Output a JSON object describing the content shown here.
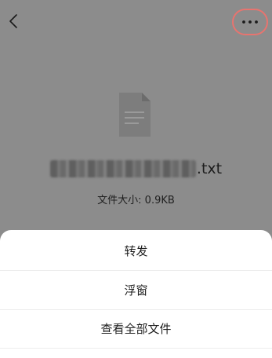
{
  "topbar": {
    "back_icon": "chevron-left-icon",
    "more_icon": "more-horizontal-icon",
    "highlight_color": "#e8746f"
  },
  "file": {
    "icon": "document-icon",
    "name_extension": ".txt",
    "size_label": "文件大小: 0.9KB"
  },
  "action_sheet": {
    "options": [
      {
        "label": "转发"
      },
      {
        "label": "浮窗"
      },
      {
        "label": "查看全部文件"
      }
    ]
  }
}
